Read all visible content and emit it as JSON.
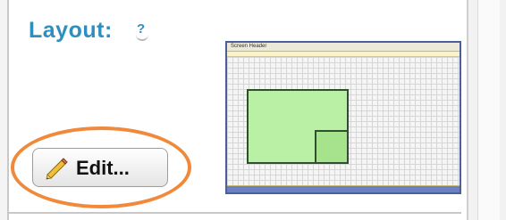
{
  "layout": {
    "title": "Layout:",
    "help_label": "?"
  },
  "preview": {
    "screen_header_text": "Screen Header"
  },
  "edit_button": {
    "label": "Edit..."
  },
  "colors": {
    "title": "#2d8fbf",
    "highlight_ring": "#f08a3a",
    "region_fill": "#b9f0a5",
    "preview_footer": "#6a80c4"
  },
  "icons": {
    "help": "question-icon",
    "edit": "pencil-icon"
  }
}
